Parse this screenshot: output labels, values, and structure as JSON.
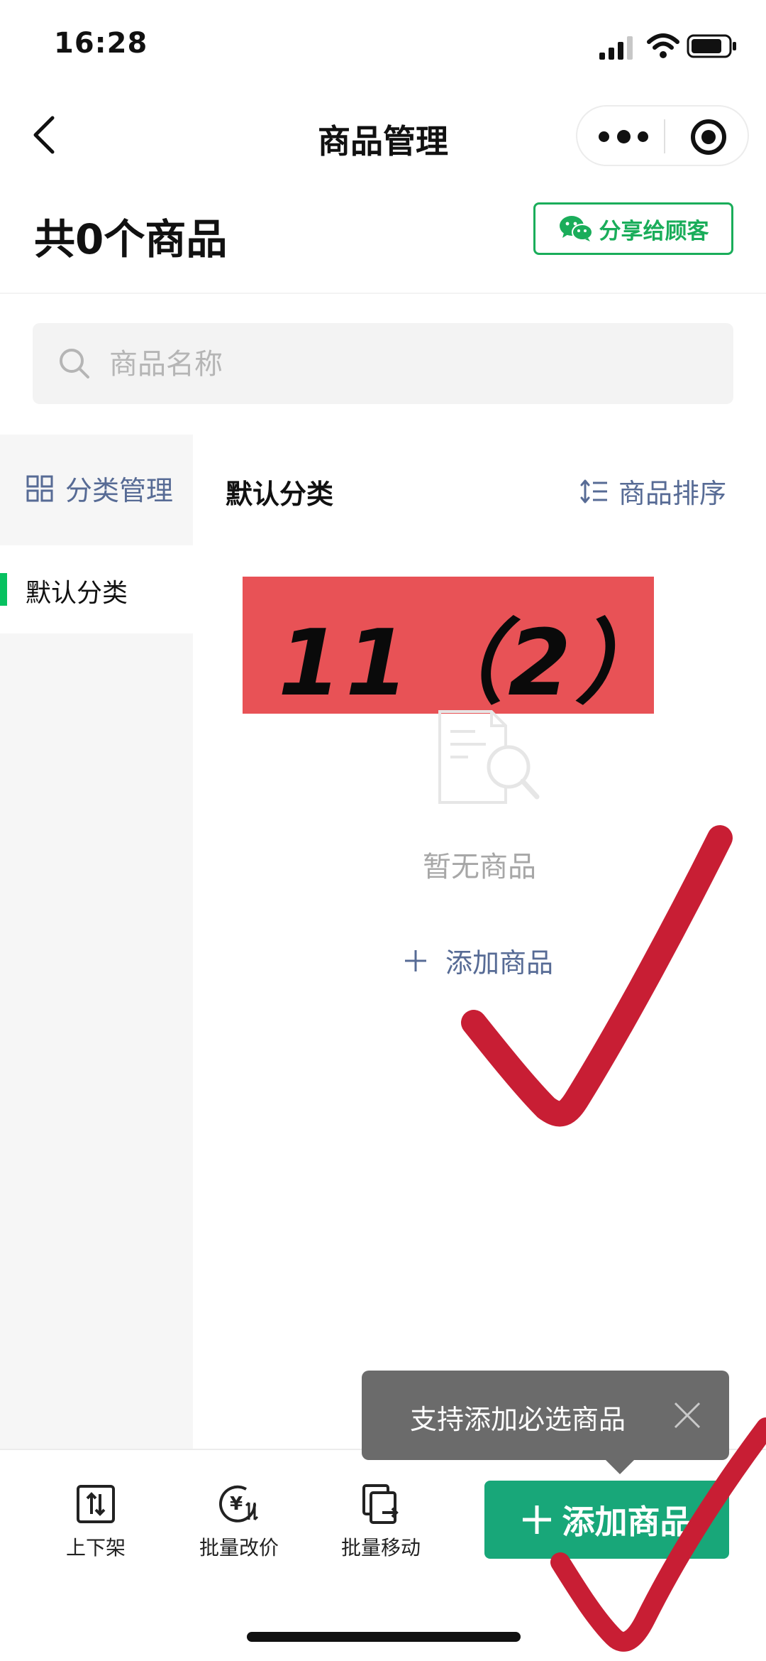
{
  "status_bar": {
    "time": "16:28"
  },
  "nav": {
    "title": "商品管理"
  },
  "header": {
    "count_title": "共0个商品",
    "share_label": "分享给顾客"
  },
  "search": {
    "placeholder": "商品名称"
  },
  "sidebar": {
    "manage_label": "分类管理",
    "items": [
      {
        "label": "默认分类",
        "active": true
      }
    ]
  },
  "content": {
    "category_title": "默认分类",
    "sort_label": "商品排序",
    "empty_text": "暂无商品",
    "add_link_label": "添加商品"
  },
  "annotation": {
    "label": "11（2）",
    "color": "#e85256"
  },
  "tooltip": {
    "text": "支持添加必选商品"
  },
  "bottom_bar": {
    "tools": [
      {
        "label": "上下架"
      },
      {
        "label": "批量改价"
      },
      {
        "label": "批量移动"
      }
    ],
    "add_button_label": "添加商品"
  },
  "colors": {
    "brand_green": "#07c160",
    "button_green": "#18a779",
    "link_blue": "#576b95",
    "check_red": "#c81e34"
  }
}
